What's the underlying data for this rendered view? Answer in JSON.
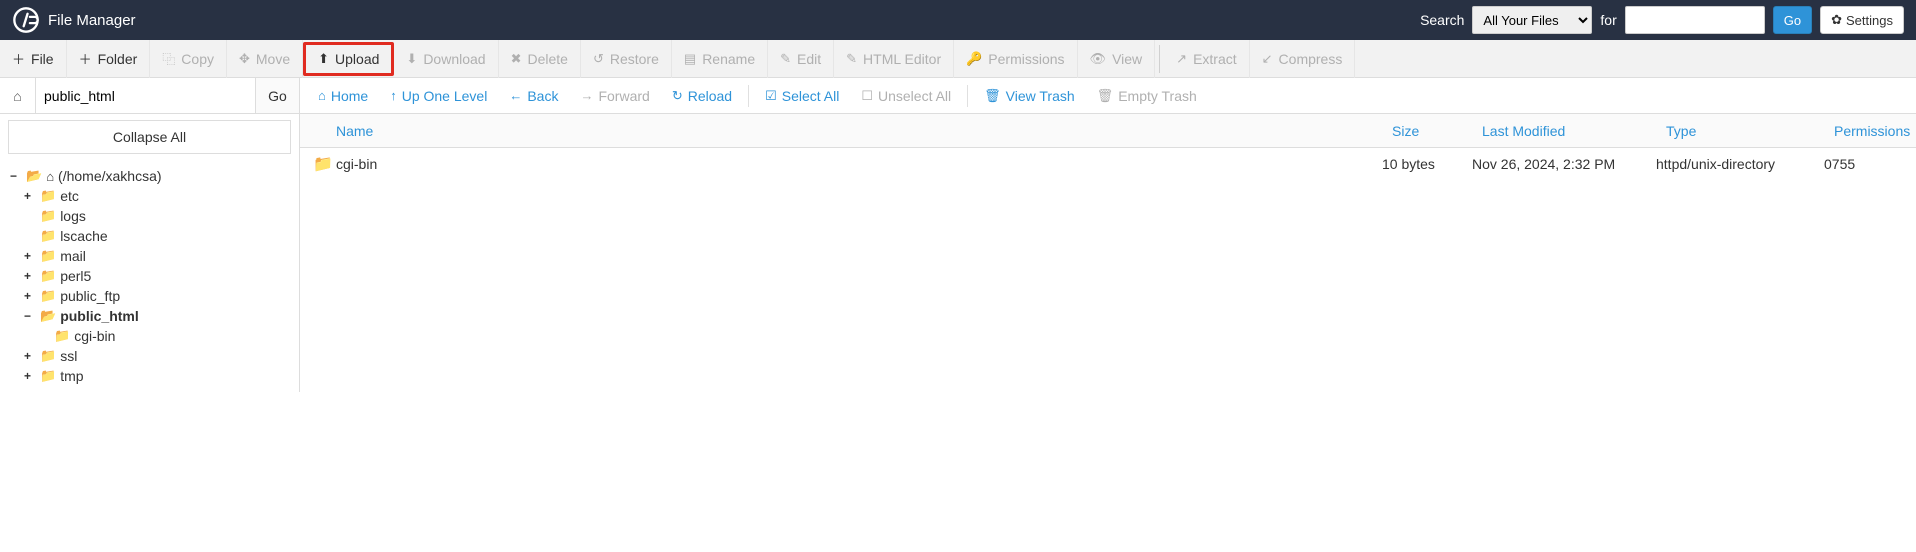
{
  "header": {
    "title": "File Manager",
    "search_label": "Search",
    "search_scope": "All Your Files",
    "for_label": "for",
    "search_value": "",
    "go": "Go",
    "settings": "Settings"
  },
  "toolbar": {
    "file": "File",
    "folder": "Folder",
    "copy": "Copy",
    "move": "Move",
    "upload": "Upload",
    "download": "Download",
    "delete": "Delete",
    "restore": "Restore",
    "rename": "Rename",
    "edit": "Edit",
    "html_editor": "HTML Editor",
    "permissions": "Permissions",
    "view": "View",
    "extract": "Extract",
    "compress": "Compress"
  },
  "sidebar": {
    "path_value": "public_html",
    "go": "Go",
    "collapse_all": "Collapse All",
    "tree": {
      "root": "(/home/xakhcsa)",
      "items": [
        {
          "toggle": "+",
          "label": "etc",
          "indent": 1
        },
        {
          "toggle": "",
          "label": "logs",
          "indent": 1
        },
        {
          "toggle": "",
          "label": "lscache",
          "indent": 1
        },
        {
          "toggle": "+",
          "label": "mail",
          "indent": 1
        },
        {
          "toggle": "+",
          "label": "perl5",
          "indent": 1
        },
        {
          "toggle": "+",
          "label": "public_ftp",
          "indent": 1
        },
        {
          "toggle": "−",
          "label": "public_html",
          "indent": 1,
          "bold": true,
          "open": true
        },
        {
          "toggle": "",
          "label": "cgi-bin",
          "indent": 2
        },
        {
          "toggle": "+",
          "label": "ssl",
          "indent": 1
        },
        {
          "toggle": "+",
          "label": "tmp",
          "indent": 1
        }
      ]
    }
  },
  "navbar": {
    "home": "Home",
    "up": "Up One Level",
    "back": "Back",
    "forward": "Forward",
    "reload": "Reload",
    "select_all": "Select All",
    "unselect_all": "Unselect All",
    "view_trash": "View Trash",
    "empty_trash": "Empty Trash"
  },
  "table": {
    "headers": {
      "name": "Name",
      "size": "Size",
      "modified": "Last Modified",
      "type": "Type",
      "permissions": "Permissions"
    },
    "rows": [
      {
        "name": "cgi-bin",
        "size": "10 bytes",
        "modified": "Nov 26, 2024, 2:32 PM",
        "type": "httpd/unix-directory",
        "permissions": "0755"
      }
    ]
  }
}
